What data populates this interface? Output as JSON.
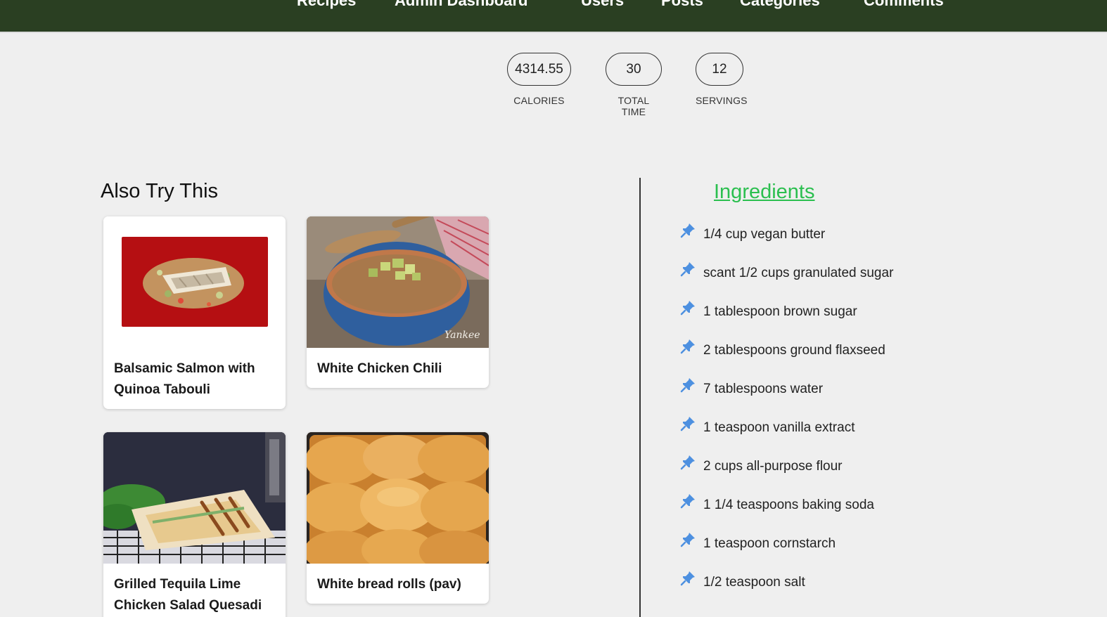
{
  "nav": {
    "items": [
      "Recipes",
      "Admin Dashboard",
      "Users",
      "Posts",
      "Categories",
      "Comments"
    ]
  },
  "stats": {
    "calories": {
      "value": "4314.55",
      "label": "CALORIES"
    },
    "total_time": {
      "value": "30",
      "label": "TOTAL TIME"
    },
    "servings": {
      "value": "12",
      "label": "SERVINGS"
    }
  },
  "also_try": {
    "title": "Also Try This",
    "cards": [
      {
        "title": "Balsamic Salmon with Quinoa Tabouli"
      },
      {
        "title": "White Chicken Chili"
      },
      {
        "title": "Grilled Tequila Lime Chicken Salad Quesadi"
      },
      {
        "title": "White bread rolls (pav)"
      }
    ]
  },
  "ingredients": {
    "title": "Ingredients",
    "items": [
      "1/4 cup vegan butter",
      "scant 1/2 cups granulated sugar",
      "1 tablespoon brown sugar",
      "2 tablespoons ground flaxseed",
      "7 tablespoons water",
      "1 teaspoon vanilla extract",
      "2 cups all-purpose flour",
      "1 1/4 teaspoons baking soda",
      "1 teaspoon cornstarch",
      "1/2 teaspoon salt"
    ]
  },
  "colors": {
    "nav_bg": "#2a3f22",
    "ingredients_title": "#2bbf4f",
    "pin_icon": "#4d90e0"
  }
}
